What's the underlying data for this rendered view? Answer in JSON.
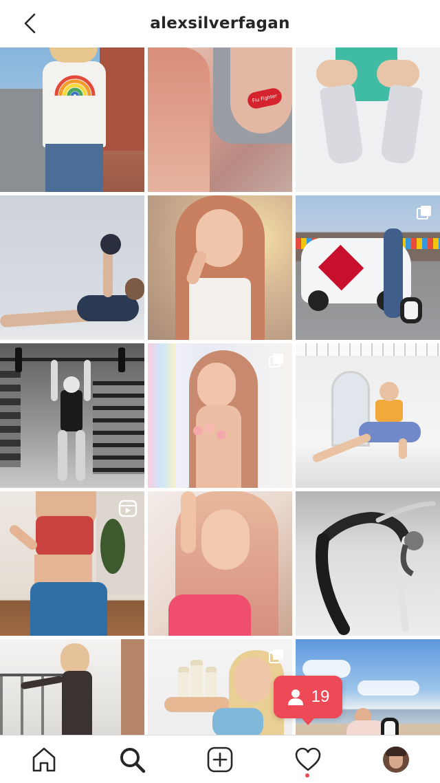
{
  "header": {
    "username": "alexsilverfagan"
  },
  "grid": {
    "tiles": [
      {
        "desc": "rainbow-tshirt",
        "badge": "none",
        "flu_text": ""
      },
      {
        "desc": "flu-fighter-bandage",
        "badge": "none",
        "flu_text": "Flu Fighter"
      },
      {
        "desc": "teal-outfit-boots",
        "badge": "none",
        "flu_text": ""
      },
      {
        "desc": "kettlebell-workout",
        "badge": "none",
        "flu_text": ""
      },
      {
        "desc": "portrait-pointing",
        "badge": "none",
        "flu_text": ""
      },
      {
        "desc": "car-with-bow",
        "badge": "multi",
        "flu_text": ""
      },
      {
        "desc": "barbell-lift",
        "badge": "none",
        "flu_text": ""
      },
      {
        "desc": "roses-portrait",
        "badge": "multi",
        "flu_text": ""
      },
      {
        "desc": "stretch-pose",
        "badge": "none",
        "flu_text": ""
      },
      {
        "desc": "red-sports-bra",
        "badge": "reel",
        "flu_text": ""
      },
      {
        "desc": "pink-hair-selfie",
        "badge": "none",
        "flu_text": ""
      },
      {
        "desc": "backbend-bw",
        "badge": "none",
        "flu_text": ""
      },
      {
        "desc": "rooftop-dress",
        "badge": "none",
        "flu_text": ""
      },
      {
        "desc": "shampoo-bottles",
        "badge": "multi",
        "flu_text": ""
      },
      {
        "desc": "beach-with-dog",
        "badge": "none",
        "flu_text": ""
      }
    ]
  },
  "notification": {
    "follower_count": "19"
  },
  "tabbar": {
    "items": [
      "home-icon",
      "search-icon",
      "new-post-icon",
      "activity-icon",
      "profile-avatar"
    ],
    "active_dot_color": "#ed4956"
  },
  "colors": {
    "text": "#262626",
    "accent": "#ed4956",
    "border": "#dbdbdb"
  }
}
